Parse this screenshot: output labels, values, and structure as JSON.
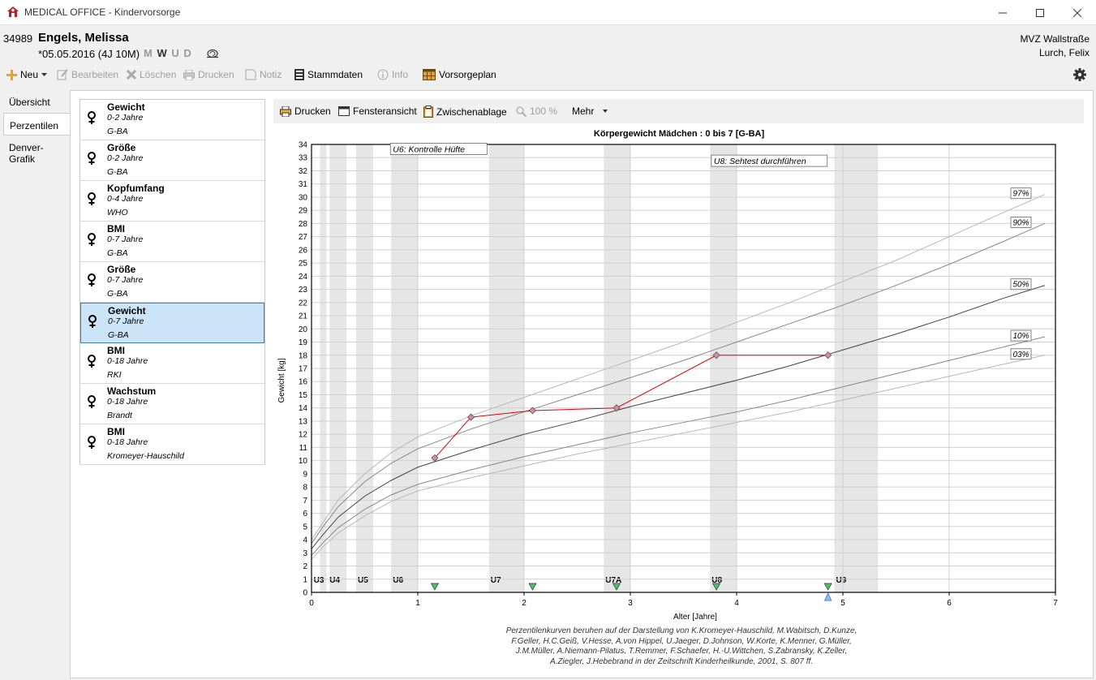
{
  "window": {
    "title": "MEDICAL OFFICE - Kindervorsorge"
  },
  "patient": {
    "id": "34989",
    "name": "Engels, Melissa",
    "dob": "*05.05.2016 (4J 10M)",
    "flags": [
      "M",
      "W",
      "U",
      "D"
    ],
    "active_flag": "W",
    "practice": "MVZ Wallstraße",
    "doctor": "Lurch, Felix"
  },
  "toolbar": {
    "new": "Neu",
    "edit": "Bearbeiten",
    "delete": "Löschen",
    "print": "Drucken",
    "note": "Notiz",
    "master_data": "Stammdaten",
    "info": "Info",
    "plan": "Vorsorgeplan"
  },
  "tabs": [
    "Übersicht",
    "Perzentilen",
    "Denver-Grafik"
  ],
  "active_tab": "Perzentilen",
  "percentile_list": [
    {
      "title": "Gewicht",
      "range": "0-2 Jahre",
      "source": "G-BA"
    },
    {
      "title": "Größe",
      "range": "0-2 Jahre",
      "source": "G-BA"
    },
    {
      "title": "Kopfumfang",
      "range": "0-4 Jahre",
      "source": "WHO"
    },
    {
      "title": "BMI",
      "range": "0-7 Jahre",
      "source": "G-BA"
    },
    {
      "title": "Größe",
      "range": "0-7 Jahre",
      "source": "G-BA"
    },
    {
      "title": "Gewicht",
      "range": "0-7 Jahre",
      "source": "G-BA",
      "selected": true
    },
    {
      "title": "BMI",
      "range": "0-18 Jahre",
      "source": "RKI"
    },
    {
      "title": "Wachstum",
      "range": "0-18 Jahre",
      "source": "Brandt"
    },
    {
      "title": "BMI",
      "range": "0-18 Jahre",
      "source": "Kromeyer-Hauschild"
    }
  ],
  "chart_toolbar": {
    "print": "Drucken",
    "window_view": "Fensteransicht",
    "clipboard": "Zwischenablage",
    "zoom": "100 %",
    "more": "Mehr"
  },
  "chart_data": {
    "type": "line",
    "title": "Körpergewicht  Mädchen :  0 bis 7 [G-BA]",
    "xlabel": "Alter [Jahre]",
    "ylabel": "Gewicht [kg]",
    "xlim": [
      0,
      7
    ],
    "ylim": [
      0,
      34
    ],
    "xticks": [
      0,
      1,
      2,
      3,
      4,
      5,
      6,
      7
    ],
    "yticks": [
      0,
      1,
      2,
      3,
      4,
      5,
      6,
      7,
      8,
      9,
      10,
      11,
      12,
      13,
      14,
      15,
      16,
      17,
      18,
      19,
      20,
      21,
      22,
      23,
      24,
      25,
      26,
      27,
      28,
      29,
      30,
      31,
      32,
      33,
      34
    ],
    "grid": true,
    "percentiles": [
      {
        "name": "97%",
        "x": [
          0,
          0.1,
          0.25,
          0.5,
          0.75,
          1,
          1.5,
          2,
          2.5,
          3,
          3.5,
          4,
          4.5,
          5,
          5.5,
          6,
          6.5,
          6.9
        ],
        "y": [
          4.0,
          5.2,
          7.0,
          9.0,
          10.6,
          11.8,
          13.4,
          14.8,
          16.2,
          17.6,
          19.0,
          20.5,
          22.0,
          23.6,
          25.2,
          27.0,
          28.8,
          30.2
        ]
      },
      {
        "name": "90%",
        "x": [
          0,
          0.1,
          0.25,
          0.5,
          0.75,
          1,
          1.5,
          2,
          2.5,
          3,
          3.5,
          4,
          4.5,
          5,
          5.5,
          6,
          6.5,
          6.9
        ],
        "y": [
          3.7,
          4.9,
          6.5,
          8.4,
          9.8,
          10.9,
          12.4,
          13.7,
          15.0,
          16.3,
          17.6,
          19.0,
          20.4,
          21.8,
          23.3,
          24.9,
          26.6,
          28.0
        ]
      },
      {
        "name": "50%",
        "x": [
          0,
          0.1,
          0.25,
          0.5,
          0.75,
          1,
          1.5,
          2,
          2.5,
          3,
          3.5,
          4,
          4.5,
          5,
          5.5,
          6,
          6.5,
          6.9
        ],
        "y": [
          3.3,
          4.3,
          5.7,
          7.3,
          8.5,
          9.5,
          10.8,
          12.0,
          13.0,
          14.1,
          15.1,
          16.1,
          17.2,
          18.4,
          19.6,
          20.9,
          22.3,
          23.3
        ]
      },
      {
        "name": "10%",
        "x": [
          0,
          0.1,
          0.25,
          0.5,
          0.75,
          1,
          1.5,
          2,
          2.5,
          3,
          3.5,
          4,
          4.5,
          5,
          5.5,
          6,
          6.5,
          6.9
        ],
        "y": [
          2.8,
          3.7,
          4.9,
          6.3,
          7.4,
          8.2,
          9.3,
          10.3,
          11.2,
          12.1,
          12.9,
          13.7,
          14.6,
          15.6,
          16.6,
          17.6,
          18.6,
          19.4
        ]
      },
      {
        "name": "03%",
        "x": [
          0,
          0.1,
          0.25,
          0.5,
          0.75,
          1,
          1.5,
          2,
          2.5,
          3,
          3.5,
          4,
          4.5,
          5,
          5.5,
          6,
          6.5,
          6.9
        ],
        "y": [
          2.5,
          3.4,
          4.5,
          5.8,
          6.9,
          7.7,
          8.7,
          9.6,
          10.5,
          11.3,
          12.1,
          12.9,
          13.7,
          14.6,
          15.5,
          16.4,
          17.3,
          18.0
        ]
      }
    ],
    "series": [
      {
        "x": [
          1.16,
          1.5,
          2.08,
          2.87,
          3.81,
          4.86
        ],
        "y": [
          10.2,
          13.3,
          13.8,
          14.0,
          18.0,
          18.0
        ]
      }
    ],
    "exam_bands": [
      {
        "label": "U3",
        "start": 0.08,
        "end": 0.14
      },
      {
        "label": "U4",
        "start": 0.17,
        "end": 0.33
      },
      {
        "label": "U5",
        "start": 0.42,
        "end": 0.58
      },
      {
        "label": "U6",
        "start": 0.75,
        "end": 1.0
      },
      {
        "label": "U7",
        "start": 1.67,
        "end": 2.0
      },
      {
        "label": "U7A",
        "start": 2.75,
        "end": 3.0
      },
      {
        "label": "U8",
        "start": 3.75,
        "end": 4.0
      },
      {
        "label": "U9",
        "start": 4.92,
        "end": 5.33
      }
    ],
    "exam_markers": [
      1.16,
      2.08,
      2.87,
      3.81,
      4.86
    ],
    "current_age": 4.86,
    "notes": [
      {
        "text": "U6: Kontrolle Hüfte",
        "x": 0.75,
        "y": 33.6
      },
      {
        "text": "U8: Sehtest durchführen",
        "x": 3.77,
        "y": 32.7
      }
    ],
    "colors": {
      "data": "#e00000",
      "marker": "#d98aa5",
      "band": "#e6e6e6",
      "exam_marker": "#4fc06a",
      "current_marker": "#4a7fd8"
    }
  },
  "caption": [
    "Perzentilenkurven beruhen auf der Darstellung von K.Kromeyer-Hauschild, M.Wabitsch, D.Kunze,",
    "F.Geller, H.C.Geiß, V.Hesse, A.von Hippel, U.Jaeger, D.Johnson, W.Korte, K.Menner, G.Müller,",
    "J.M.Müller, A.Niemann-Pilatus, T.Remmer, F.Schaefer, H.-U.Wittchen, S.Zabransky, K.Zeller,",
    "A.Ziegler, J.Hebebrand in der Zeitschrift Kinderheilkunde, 2001, S. 807 ff."
  ]
}
